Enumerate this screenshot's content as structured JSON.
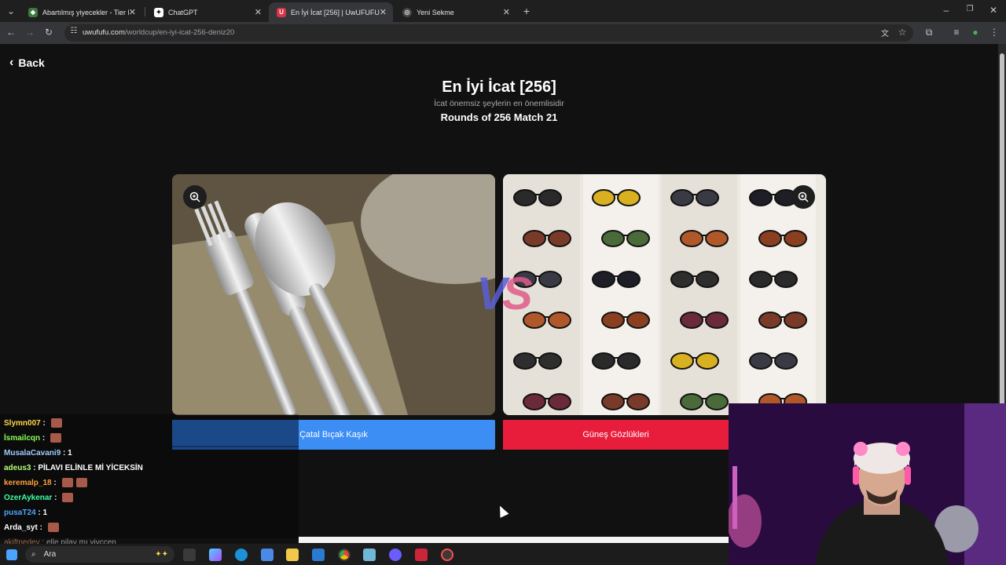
{
  "browser": {
    "tabs": [
      {
        "title": "Abartılmış yiyecekler - Tier List",
        "active": false
      },
      {
        "title": "ChatGPT",
        "active": false
      },
      {
        "title": "En İyi İcat [256] | UwUFUFU",
        "active": true
      },
      {
        "title": "Yeni Sekme",
        "active": false
      }
    ],
    "url_host": "uwufufu.com",
    "url_path": "/worldcup/en-iyi-icat-256-deniz20"
  },
  "page": {
    "back_label": "Back",
    "title": "En İyi İcat [256]",
    "subtitle": "İcat önemsiz şeylerin en önemlisidir",
    "round": "Rounds of 256 Match 21",
    "vs_left": "V",
    "vs_right": "S",
    "choices": [
      {
        "label": "Çatal Bıçak Kaşık",
        "color": "#3c8ef5",
        "image": "cutlery-image"
      },
      {
        "label": "Güneş Gözlükleri",
        "color": "#e81c3b",
        "image": "sunglasses-image"
      }
    ]
  },
  "chat": [
    {
      "user": "Slymn007",
      "color": "#ffd84d",
      "text": "",
      "emotes": 1
    },
    {
      "user": "İsmailcqn",
      "color": "#8cff5a",
      "text": "",
      "emotes": 1
    },
    {
      "user": "MusalaCavani9",
      "color": "#9ecbff",
      "text": "1",
      "emotes": 0
    },
    {
      "user": "adeus3",
      "color": "#b6ff7a",
      "text": "PİLAVI ELİNLE Mİ YİCEKSİN",
      "emotes": 0
    },
    {
      "user": "keremalp_18",
      "color": "#ff9f3d",
      "text": "",
      "emotes": 2
    },
    {
      "user": "OzerAykenar",
      "color": "#3dffa5",
      "text": "",
      "emotes": 1
    },
    {
      "user": "pusaT24",
      "color": "#4da6ff",
      "text": "1",
      "emotes": 0
    },
    {
      "user": "Arda_syt",
      "color": "#ffffff",
      "text": "",
      "emotes": 1
    },
    {
      "user": "akiftnedev",
      "color": "#ffb07a",
      "text": "elle pilav mı yiyccen",
      "emotes": 0
    }
  ],
  "taskbar": {
    "search_placeholder": "Ara"
  }
}
